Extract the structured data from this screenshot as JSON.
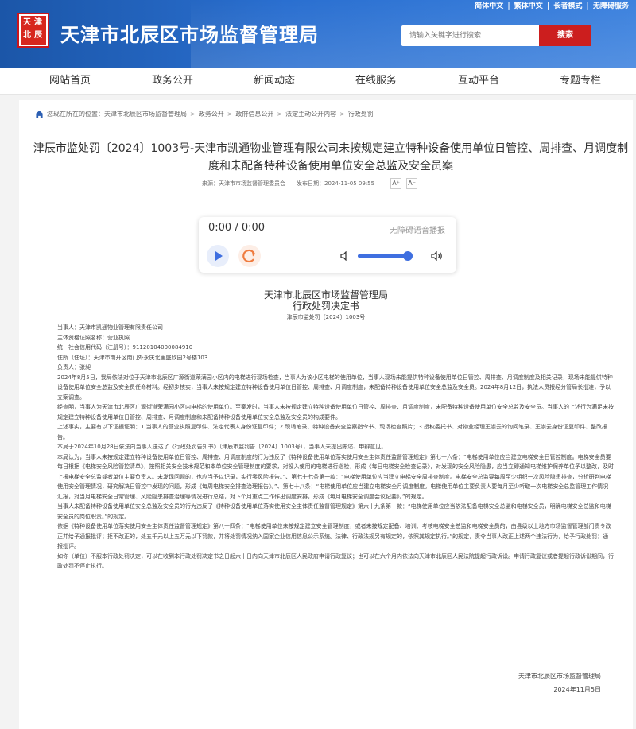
{
  "header": {
    "site_title": "天津市北辰区市场监督管理局",
    "emblem_text": [
      "天",
      "津",
      "北",
      "辰"
    ],
    "top_links": [
      "简体中文",
      "|",
      "繁体中文",
      "|",
      "长者模式",
      "|",
      "无障碍服务"
    ],
    "search_placeholder": "请输入关键字进行搜索",
    "search_button": "搜索"
  },
  "nav": [
    "网站首页",
    "政务公开",
    "新闻动态",
    "在线服务",
    "互动平台",
    "专题专栏"
  ],
  "breadcrumb": {
    "prefix": "您现在所在的位置：",
    "items": [
      "天津市北辰区市场监督管理局",
      "政务公开",
      "政府信息公开",
      "法定主动公开内容",
      "行政处罚"
    ],
    "separator": ">"
  },
  "article": {
    "title": "津辰市监处罚〔2024〕1003号-天津市凯通物业管理有限公司未按规定建立特种设备使用单位日管控、周排查、月调度制度和未配备特种设备使用单位安全总监及安全员案",
    "source_label": "来源：",
    "source": "天津市市场监督管理委员会",
    "date_label": "发布日期：",
    "date": "2024-11-05 09:55",
    "font_up": "A⁺",
    "font_down": "A⁻"
  },
  "player": {
    "time": "0:00 / 0:00",
    "tag": "无障碍语音播报",
    "volume": 0.9
  },
  "decision": {
    "org": "天津市北辰区市场监督管理局",
    "title": "行政处罚决定书",
    "number": "津辰市监处罚〔2024〕1003号",
    "paragraphs": [
      "当事人：天津市凯通物业管理有限责任公司",
      "主体资格证照名称：营业执照",
      "统一社会信用代码（注册号）：91120104000084910",
      "住所（住址）：天津市南开区南门外永庆北里盛欣园2号楼103",
      "负责人：张昶",
      "2024年8月5日，我局依法对位于天津市北辰区广源街道荣满园小区内的电梯进行现场检查，当事人为该小区电梯的使用单位，当事人现场未能提供特种设备使用单位日管控、周排查、月调度制度及相关记录，现场未能提供特种设备使用单位安全总监及安全员任命材料。经初步核实，当事人未按规定建立特种设备使用单位日管控、周排查、月调度制度，未配备特种设备使用单位安全总监及安全员。2024年8月12日，执法人员报经分管局长批准，予以立案调查。",
      "经查明，当事人为天津市北辰区广源街道荣满园小区内电梯的使用单位。至案发时，当事人未按规定建立特种设备使用单位日管控、周排查、月调度制度，未配备特种设备使用单位安全总监及安全员。当事人的上述行为满足未按规定建立特种设备使用单位日管控、周排查、月调度制度和未配备特种设备使用单位安全总监及安全员的构成要件。",
      "上述事实，主要有以下证据证明：1.当事人的营业执照复印件、法定代表人身份证复印件；2.现场笔录、特种设备安全监察指令书、现场检查照片；3.授权委托书、对物业经理王崇云的询问笔录、王崇云身份证复印件、整改报告。",
      "本局于2024年10月28日依法向当事人送达了《行政处罚告知书》（津辰市监罚告〔2024〕1003号），当事人未提出陈述、申辩意见。",
      "本局认为，当事人未按规定建立特种设备使用单位日管控、周排查、月调度制度的行为违反了《特种设备使用单位落实使用安全主体责任监督管理规定》第七十六条：“电梯使用单位应当建立电梯安全日管控制度。电梯安全员要每日根据《电梯安全风险管控清单》，按照相关安全技术规范和本单位安全管理制度的要求，对投入使用的电梯进行巡检，形成《每日电梯安全检查记录》，对发现的安全风险隐患，应当立即通知电梯维护保养单位予以整改，及时上报电梯安全总监或者单位主要负责人。未发现问题的，也应当予以记录，实行零风险报告。”、第七十七条第一款：“电梯使用单位应当建立电梯安全周排查制度。电梯安全总监要每周至少组织一次风险隐患排查，分析研判电梯使用安全管理情况，研究解决日管控中发现的问题，形成《每周电梯安全排查治理报告》。”、第七十八条：“电梯使用单位应当建立电梯安全月调度制度。电梯使用单位主要负责人要每月至少听取一次电梯安全总监管理工作情况汇报，对当月电梯安全日常管理、风险隐患排查治理等情况进行总结，对下个月重点工作作出调度安排，形成《每月电梯安全调度会议纪要》。”的规定。",
      "当事人未配备特种设备使用单位安全总监及安全员的行为违反了《特种设备使用单位落实使用安全主体责任监督管理规定》第六十九条第一款：“电梯使用单位应当依法配备电梯安全总监和电梯安全员，明确电梯安全总监和电梯安全员的岗位职责。”的规定。",
      "依据《特种设备使用单位落实使用安全主体责任监督管理规定》第八十四条：“电梯使用单位未按规定建立安全管理制度，或者未按规定配备、培训、考核电梯安全总监和电梯安全员的，由县级以上地方市场监督管理部门责令改正并给予通报批评；拒不改正的，处五千元以上五万元以下罚款，并将处罚情况纳入国家企业信用信息公示系统。法律、行政法规另有规定的，依照其规定执行。”的规定，责令当事人改正上述两个违法行为，给予行政处罚：通报批评。",
      "如你（单位）不服本行政处罚决定，可以在收到本行政处罚决定书之日起六十日内向天津市北辰区人民政府申请行政复议；也可以在六个月内依法向天津市北辰区人民法院提起行政诉讼。申请行政复议或者提起行政诉讼期间，行政处罚不停止执行。"
    ],
    "sign_org": "天津市北辰区市场监督管理局",
    "sign_date": "2024年11月5日"
  }
}
